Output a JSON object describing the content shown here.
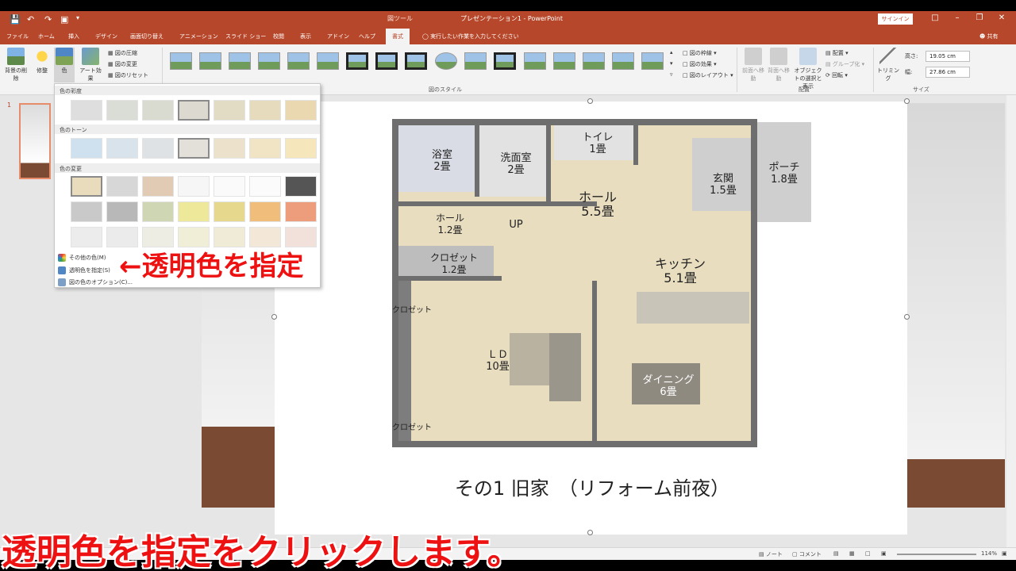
{
  "app": {
    "context_tab_group": "図ツール",
    "window_title": "プレゼンテーション1 - PowerPoint",
    "signin": "サインイン",
    "share": "共有"
  },
  "tabs": [
    "ファイル",
    "ホーム",
    "挿入",
    "デザイン",
    "画面切り替え",
    "アニメーション",
    "スライド ショー",
    "校閲",
    "表示",
    "アドイン",
    "ヘルプ",
    "書式"
  ],
  "tell_me": "実行したい作業を入力してください",
  "ribbon": {
    "remove_bg": "背景の削除",
    "correct": "修整",
    "color": "色",
    "art_effect": "アート効果",
    "compress": "図の圧縮",
    "change": "図の変更",
    "reset": "図のリセット",
    "styles_group": "図のスタイル",
    "border": "図の枠線",
    "effects": "図の効果",
    "layout": "図のレイアウト",
    "bring_forward": "前面へ移動",
    "send_backward": "背面へ移動",
    "selection_pane": "オブジェクトの選択と表示",
    "align": "配置",
    "group": "グループ化",
    "rotate": "回転",
    "arrange_group": "配置",
    "crop": "トリミング",
    "height_label": "高さ:",
    "height_value": "19.05 cm",
    "width_label": "幅:",
    "width_value": "27.86 cm",
    "size_group": "サイズ"
  },
  "dropdown": {
    "saturation": "色の彩度",
    "tone": "色のトーン",
    "recolor": "色の変更",
    "more_colors": "その他の色(M)",
    "set_transparent": "透明色を指定(S)",
    "color_options": "図の色のオプション(C)..."
  },
  "slide": {
    "number": "1",
    "title": "その1 旧家　（リフォーム前夜）",
    "rooms": {
      "bath": "浴室\n2畳",
      "washroom": "洗面室\n2畳",
      "toilet": "トイレ\n1畳",
      "entrance": "玄関\n1.5畳",
      "porch": "ポーチ\n1.8畳",
      "hall_main": "ホール\n5.5畳",
      "hall_small": "ホール\n1.2畳",
      "up": "UP",
      "closet_small": "クロゼット\n1.2畳",
      "kitchen": "キッチン\n5.1畳",
      "closet_a": "クロゼット",
      "ld": "ＬＤ\n10畳",
      "dining": "ダイニング\n6畳",
      "closet_b": "クロゼット"
    }
  },
  "annotations": {
    "callout": "←透明色を指定",
    "caption": "透明色を指定をクリックします。"
  },
  "status": {
    "notes": "ノート",
    "comments": "コメント",
    "zoom": "114%"
  },
  "colors": {
    "accent": "#b7472a",
    "annotation": "#ee1111"
  }
}
